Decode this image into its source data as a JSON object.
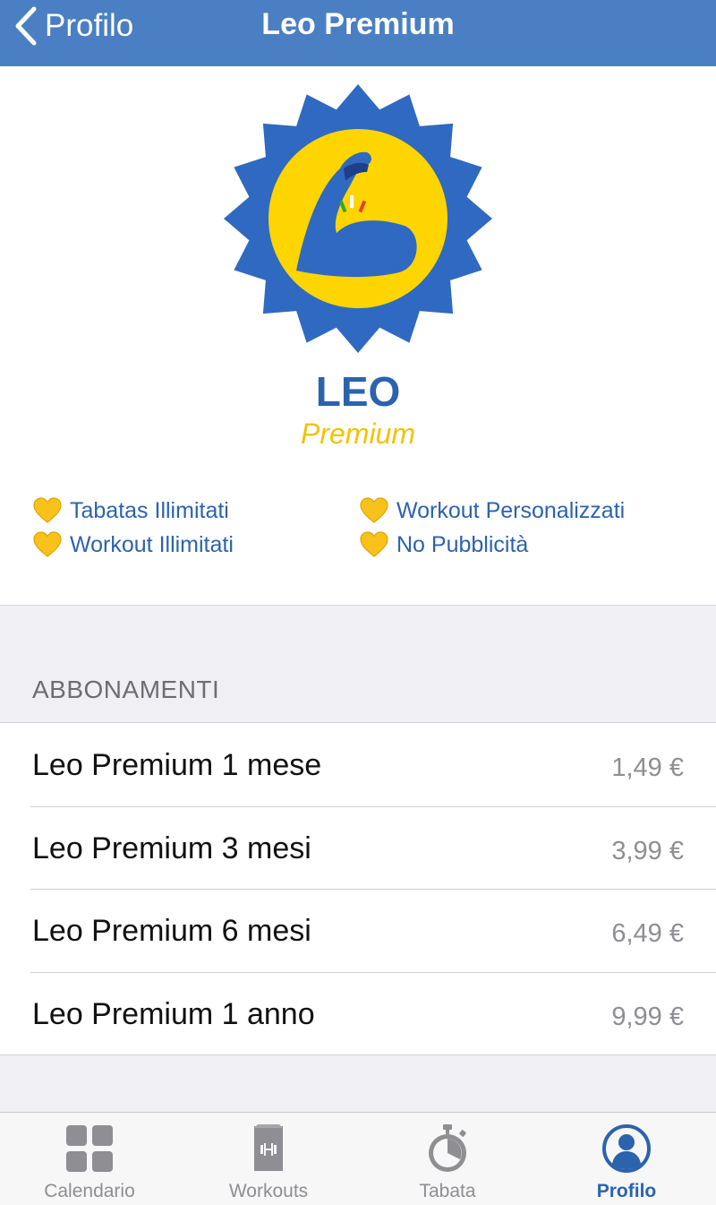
{
  "nav": {
    "back_label": "Profilo",
    "title": "Leo Premium"
  },
  "brand": {
    "name": "LEO",
    "tier": "Premium"
  },
  "features": [
    "Tabatas Illimitati",
    "Workout Illimitati",
    "Workout Personalizzati",
    "No Pubblicità"
  ],
  "subscriptions": {
    "header": "ABBONAMENTI",
    "items": [
      {
        "name": "Leo Premium 1 mese",
        "price": "1,49 €"
      },
      {
        "name": "Leo Premium 3 mesi",
        "price": "3,99 €"
      },
      {
        "name": "Leo Premium 6 mesi",
        "price": "6,49 €"
      },
      {
        "name": "Leo Premium 1 anno",
        "price": "9,99 €"
      }
    ]
  },
  "tabs": [
    {
      "label": "Calendario",
      "icon": "grid-icon",
      "active": false
    },
    {
      "label": "Workouts",
      "icon": "dumbbell-icon",
      "active": false
    },
    {
      "label": "Tabata",
      "icon": "stopwatch-icon",
      "active": false
    },
    {
      "label": "Profilo",
      "icon": "person-icon",
      "active": true
    }
  ],
  "colors": {
    "nav_bar": "#4a7fc3",
    "brand_blue": "#2c63ad",
    "brand_yellow": "#f2c300",
    "grouped_bg": "#efeff4",
    "inactive_tab": "#8e8e93"
  }
}
